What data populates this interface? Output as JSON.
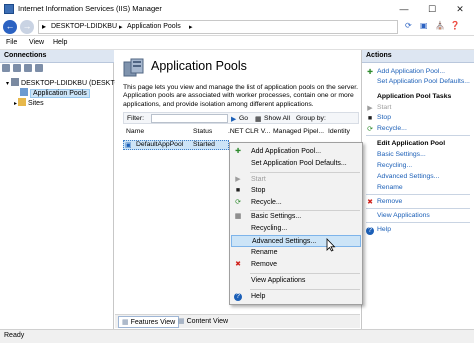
{
  "window": {
    "title": "Internet Information Services (IIS) Manager",
    "controls": {
      "minimize": "—",
      "maximize": "☐",
      "close": "✕"
    }
  },
  "address": {
    "segments": [
      "DESKTOP-LDIDKBU",
      "Application Pools"
    ]
  },
  "menu": {
    "items": [
      "File",
      "View",
      "Help"
    ]
  },
  "connections": {
    "header": "Connections",
    "tree": {
      "server": "DESKTOP-LDIDKBU (DESKTOP",
      "app_pools": "Application Pools",
      "sites": "Sites"
    }
  },
  "main": {
    "title": "Application Pools",
    "description": "This page lets you view and manage the list of application pools on the server. Application pools are associated with worker processes, contain one or more applications, and provide isolation among different applications.",
    "filter": {
      "label": "Filter:",
      "go": "Go",
      "show_all": "Show All",
      "group_by": "Group by:"
    },
    "columns": [
      "Name",
      "Status",
      ".NET CLR V...",
      "Managed Pipel...",
      "Identity"
    ],
    "rows": [
      {
        "name": "DefaultAppPool",
        "status": "Started"
      }
    ]
  },
  "tabs": {
    "features": "Features View",
    "content": "Content View"
  },
  "actions": {
    "header": "Actions",
    "add_pool": "Add Application Pool...",
    "set_defaults": "Set Application Pool Defaults...",
    "tasks_header": "Application Pool Tasks",
    "start": "Start",
    "stop": "Stop",
    "recycle": "Recycle...",
    "edit_header": "Edit Application Pool",
    "basic_settings": "Basic Settings...",
    "recycling": "Recycling...",
    "advanced_settings": "Advanced Settings...",
    "rename": "Rename",
    "remove": "Remove",
    "view_apps": "View Applications",
    "help": "Help"
  },
  "context_menu": {
    "add_pool": "Add Application Pool...",
    "set_defaults": "Set Application Pool Defaults...",
    "start": "Start",
    "stop": "Stop",
    "recycle": "Recycle...",
    "basic_settings": "Basic Settings...",
    "recycling": "Recycling...",
    "advanced_settings": "Advanced Settings...",
    "rename": "Rename",
    "remove": "Remove",
    "view_apps": "View Applications",
    "help": "Help"
  },
  "status": {
    "text": "Ready"
  },
  "colors": {
    "accent": "#1b5fb7",
    "selection": "#cce4f7",
    "pane_header": "#dde6f2",
    "remove_red": "#d0201a"
  }
}
